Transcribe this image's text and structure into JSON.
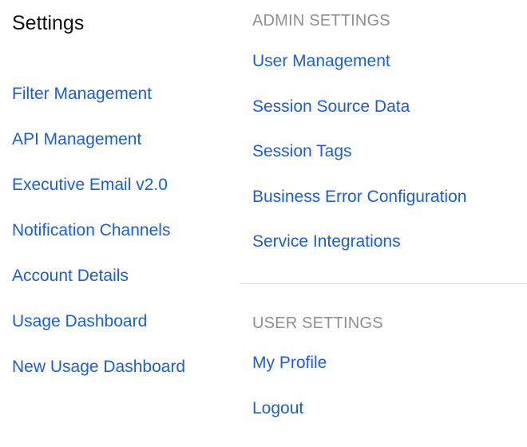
{
  "page": {
    "title": "Settings"
  },
  "left_menu": {
    "items": [
      {
        "label": "Filter Management"
      },
      {
        "label": "API Management"
      },
      {
        "label": "Executive Email v2.0"
      },
      {
        "label": "Notification Channels"
      },
      {
        "label": "Account Details"
      },
      {
        "label": "Usage Dashboard"
      },
      {
        "label": "New Usage Dashboard"
      }
    ]
  },
  "admin_settings": {
    "heading": "ADMIN SETTINGS",
    "items": [
      {
        "label": "User Management"
      },
      {
        "label": "Session Source Data"
      },
      {
        "label": "Session Tags"
      },
      {
        "label": "Business Error Configuration"
      },
      {
        "label": "Service Integrations"
      }
    ]
  },
  "user_settings": {
    "heading": "USER SETTINGS",
    "items": [
      {
        "label": "My Profile"
      },
      {
        "label": "Logout"
      }
    ]
  },
  "colors": {
    "link": "#1a5fd6",
    "heading_muted": "#8f8f8f",
    "title": "#111111",
    "divider": "#dcdcdc",
    "background": "#ffffff"
  }
}
